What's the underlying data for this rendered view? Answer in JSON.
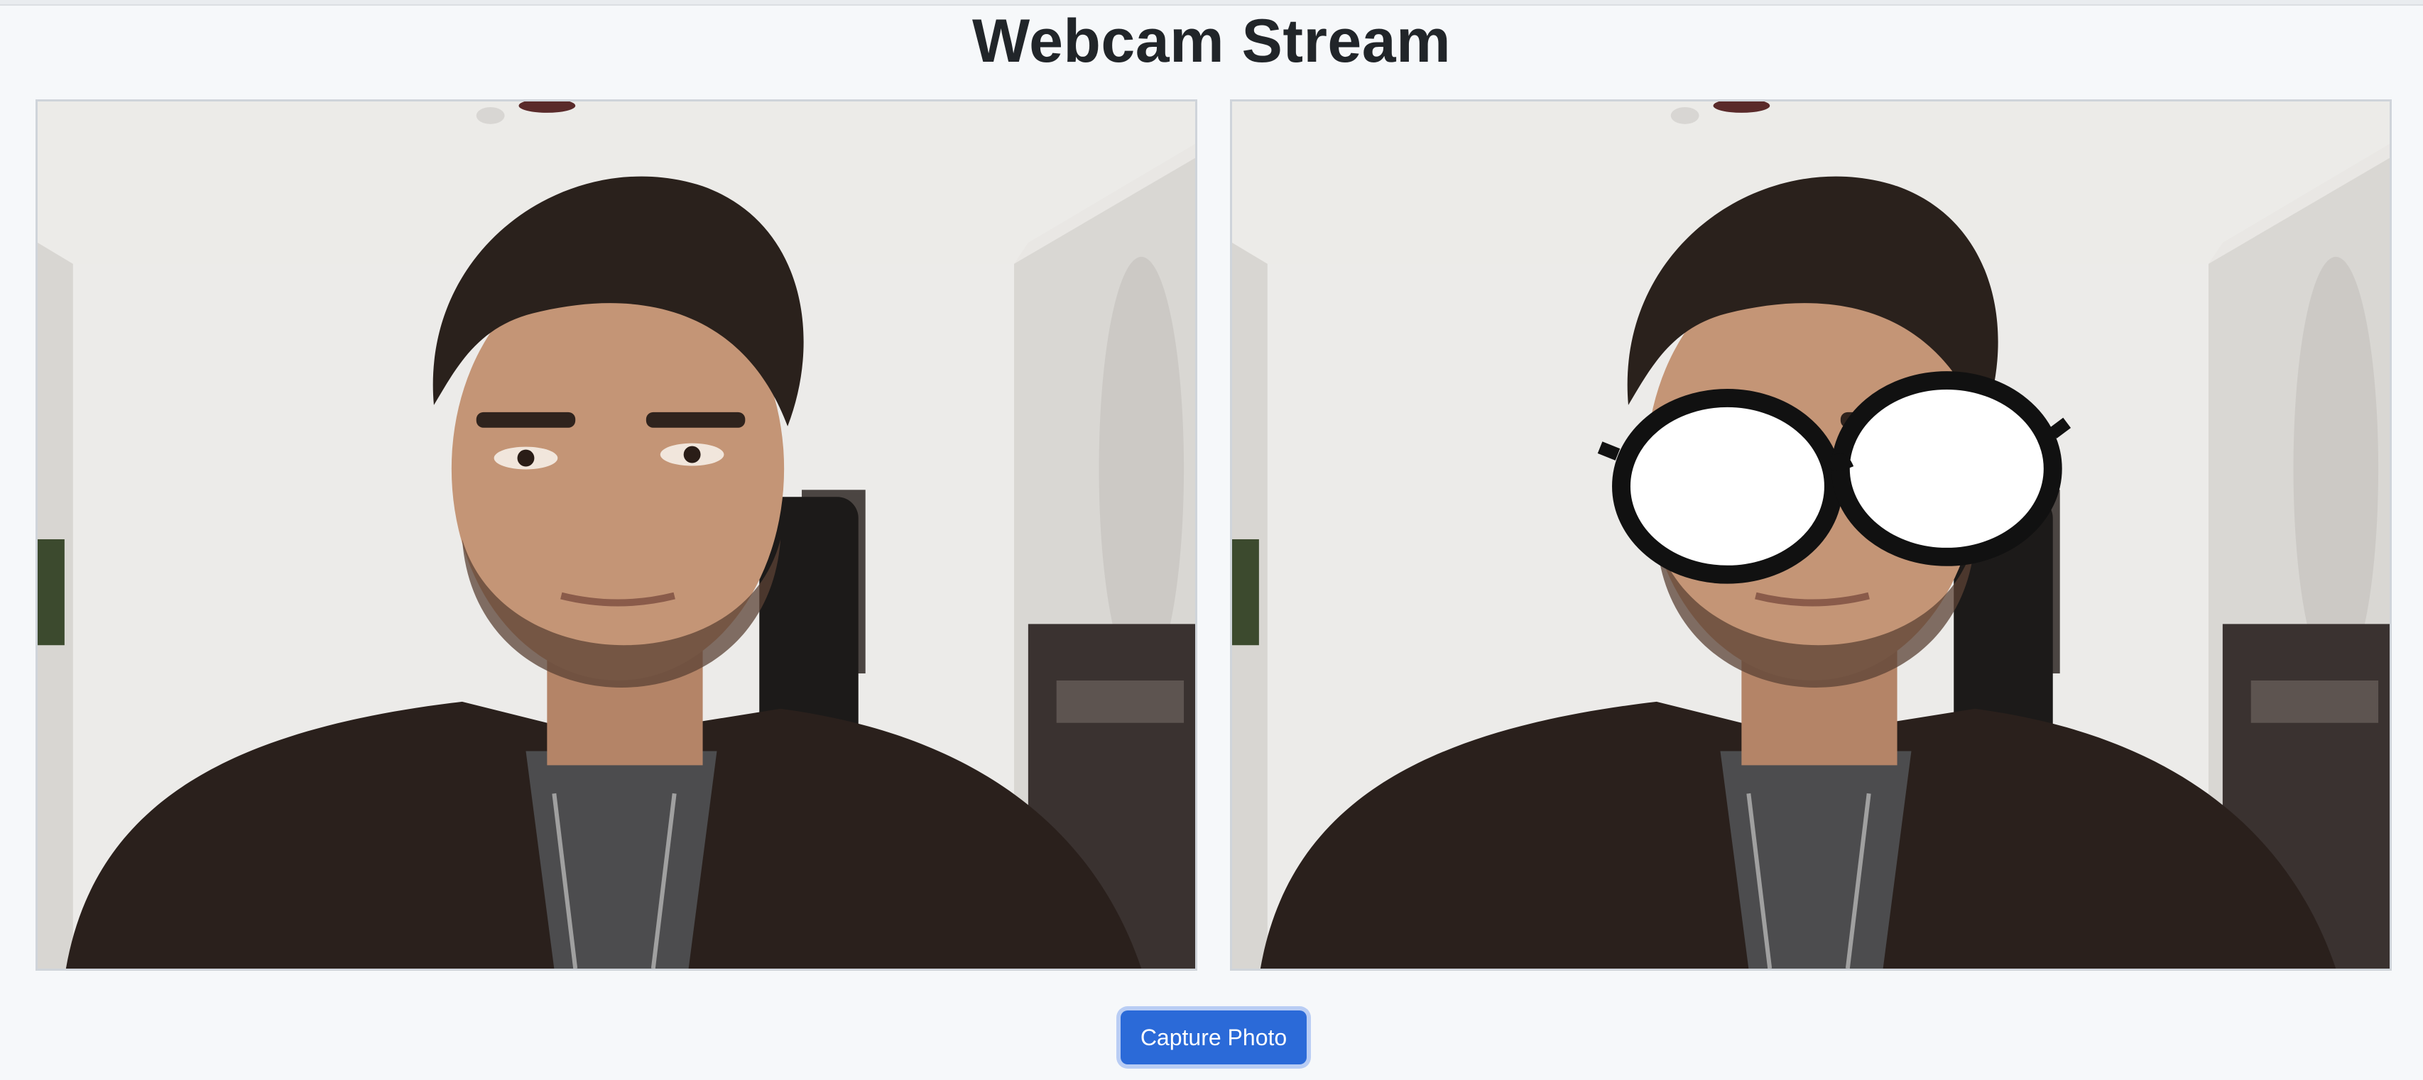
{
  "page": {
    "title": "Webcam Stream"
  },
  "streams": [
    {
      "id": "raw",
      "label": "raw-webcam-feed",
      "overlay": "none"
    },
    {
      "id": "filtered",
      "label": "filtered-webcam-feed",
      "overlay": "glasses"
    }
  ],
  "controls": {
    "capture_label": "Capture Photo"
  },
  "colors": {
    "accent": "#2b6ad8",
    "background": "#f6f8fa",
    "title": "#212529"
  }
}
